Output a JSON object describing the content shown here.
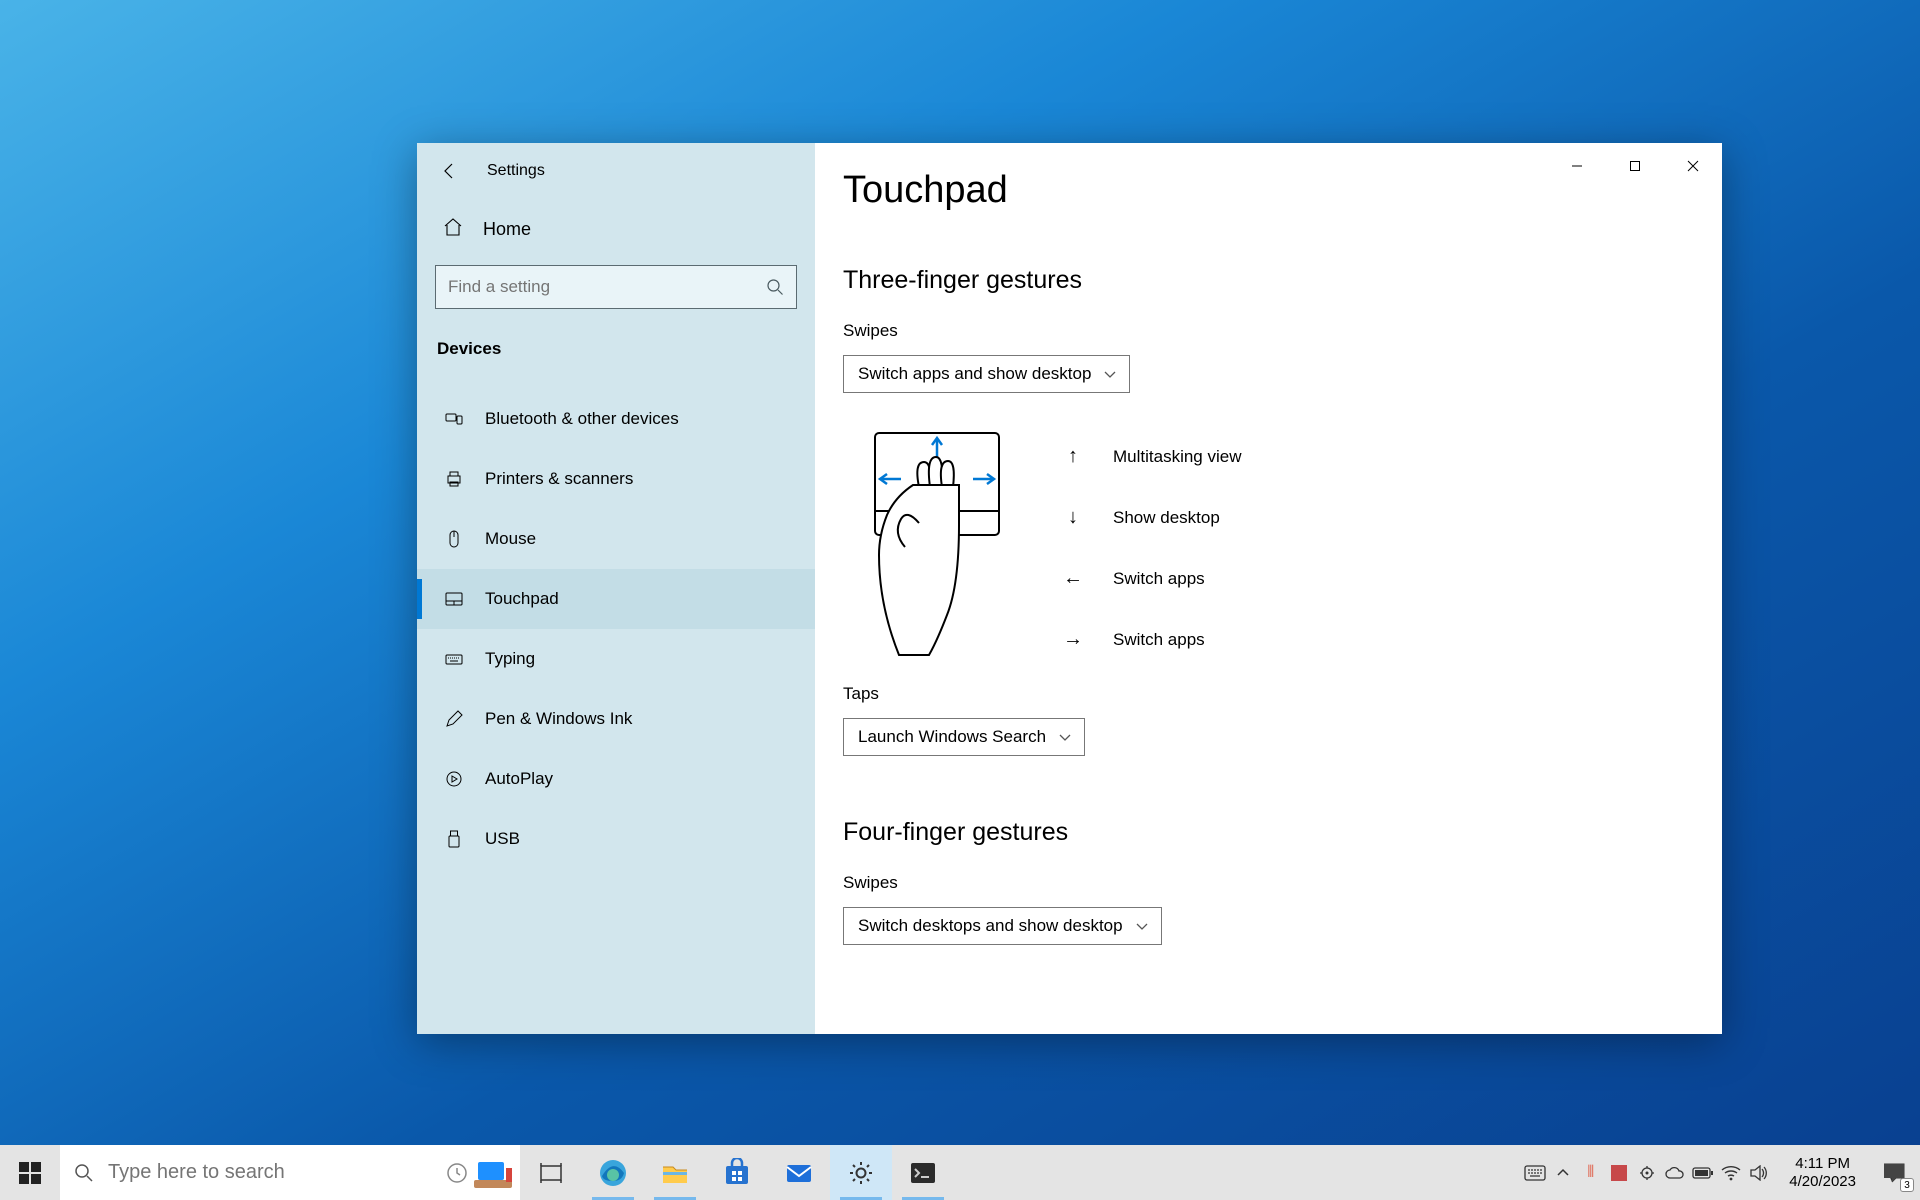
{
  "window": {
    "title": "Settings",
    "home": "Home",
    "search_placeholder": "Find a setting",
    "category": "Devices",
    "nav": [
      {
        "label": "Bluetooth & other devices",
        "icon": "bluetooth"
      },
      {
        "label": "Printers & scanners",
        "icon": "printer"
      },
      {
        "label": "Mouse",
        "icon": "mouse"
      },
      {
        "label": "Touchpad",
        "icon": "touchpad",
        "selected": true
      },
      {
        "label": "Typing",
        "icon": "typing"
      },
      {
        "label": "Pen & Windows Ink",
        "icon": "pen"
      },
      {
        "label": "AutoPlay",
        "icon": "autoplay"
      },
      {
        "label": "USB",
        "icon": "usb"
      }
    ]
  },
  "main": {
    "title": "Touchpad",
    "section1": "Three-finger gestures",
    "swipes_label": "Swipes",
    "swipes_value": "Switch apps and show desktop",
    "legend": [
      {
        "dir": "up",
        "label": "Multitasking view"
      },
      {
        "dir": "down",
        "label": "Show desktop"
      },
      {
        "dir": "left",
        "label": "Switch apps"
      },
      {
        "dir": "right",
        "label": "Switch apps"
      }
    ],
    "taps_label": "Taps",
    "taps_value": "Launch Windows Search",
    "section2": "Four-finger gestures",
    "swipes4_label": "Swipes",
    "swipes4_value": "Switch desktops and show desktop"
  },
  "taskbar": {
    "search_placeholder": "Type here to search",
    "time": "4:11 PM",
    "date": "4/20/2023",
    "notif_count": "3"
  }
}
